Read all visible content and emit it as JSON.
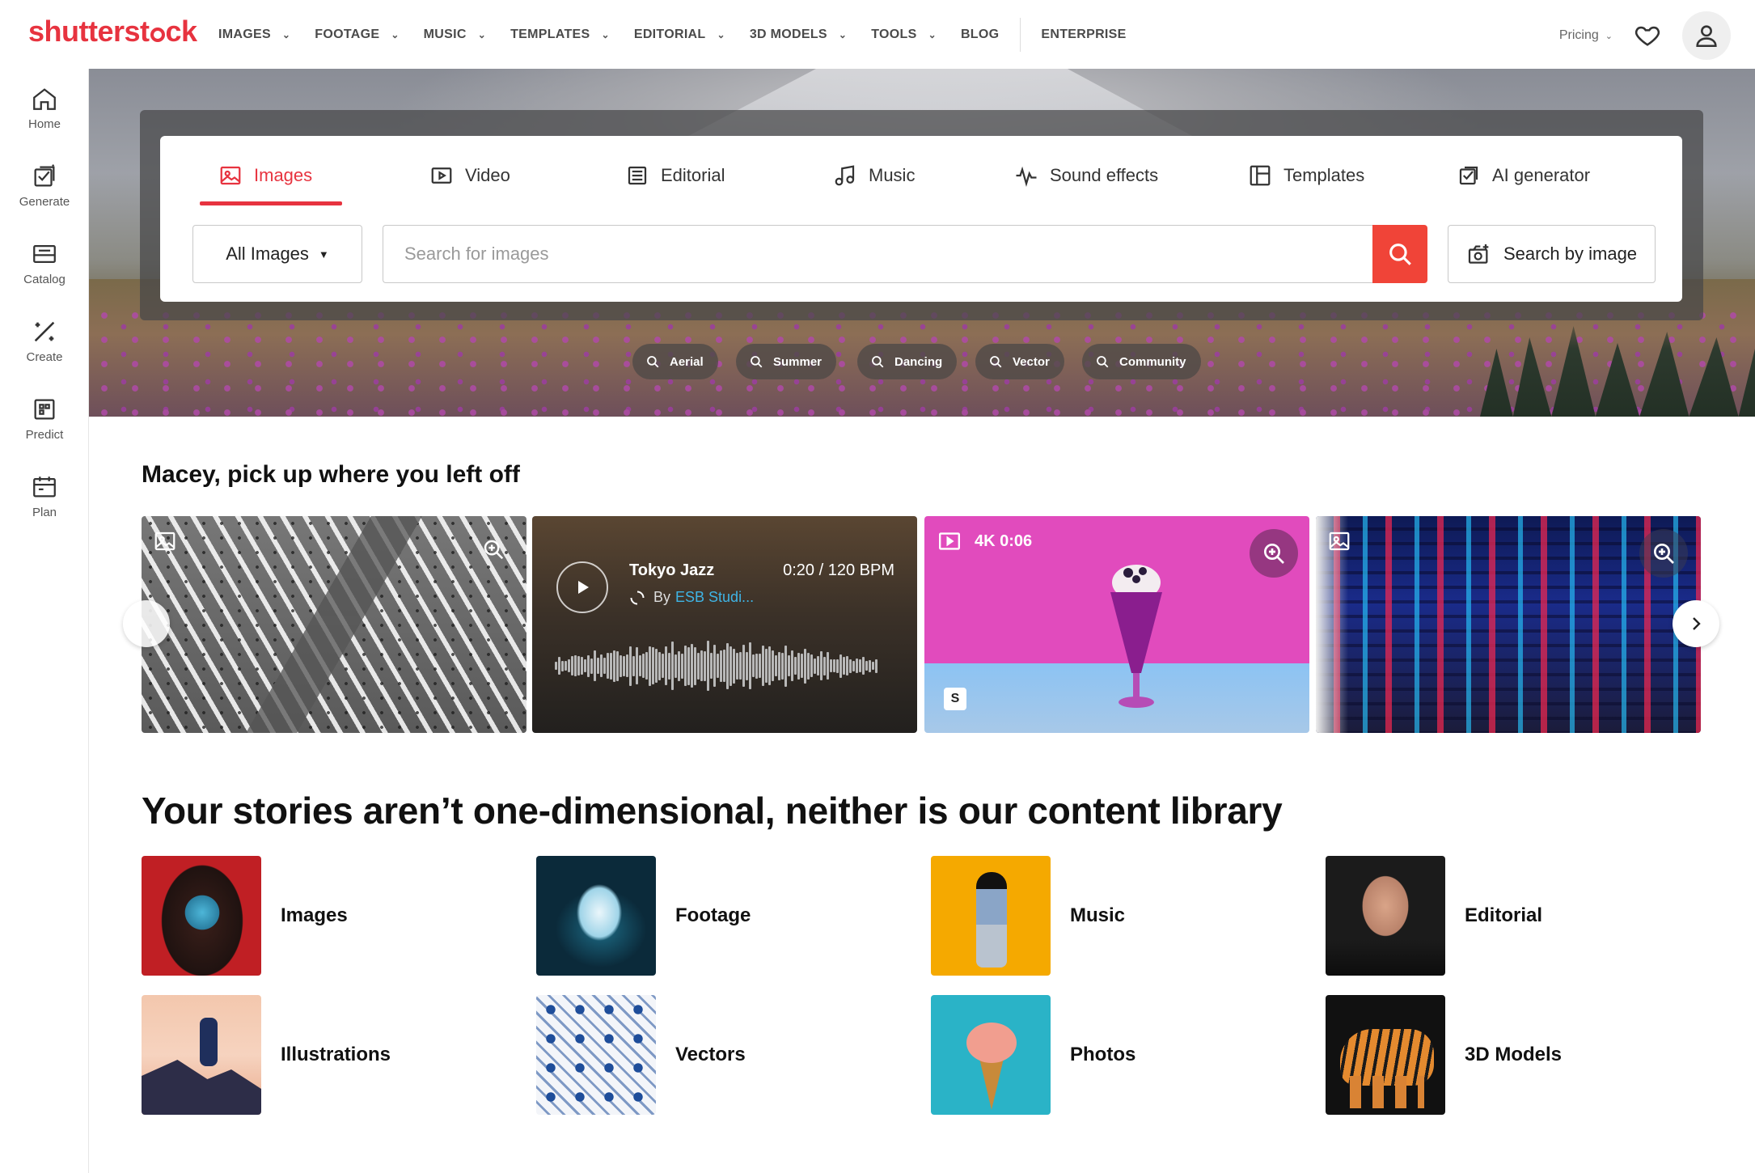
{
  "brand": {
    "logo_text": "shutterstock",
    "accent_color": "#e7333f"
  },
  "nav": {
    "items": [
      {
        "label": "IMAGES",
        "has_menu": true
      },
      {
        "label": "FOOTAGE",
        "has_menu": true
      },
      {
        "label": "MUSIC",
        "has_menu": true
      },
      {
        "label": "TEMPLATES",
        "has_menu": true
      },
      {
        "label": "EDITORIAL",
        "has_menu": true
      },
      {
        "label": "3D MODELS",
        "has_menu": true
      },
      {
        "label": "TOOLS",
        "has_menu": true
      },
      {
        "label": "BLOG",
        "has_menu": false
      },
      {
        "label": "ENTERPRISE",
        "has_menu": false
      }
    ],
    "pricing_label": "Pricing",
    "icons": {
      "favorites": "heart-icon",
      "account": "user-icon"
    }
  },
  "rail": {
    "items": [
      {
        "label": "Home",
        "icon": "home-icon"
      },
      {
        "label": "Generate",
        "icon": "generate-icon"
      },
      {
        "label": "Catalog",
        "icon": "catalog-icon"
      },
      {
        "label": "Create",
        "icon": "create-icon"
      },
      {
        "label": "Predict",
        "icon": "predict-icon"
      },
      {
        "label": "Plan",
        "icon": "plan-icon"
      }
    ]
  },
  "search": {
    "tabs": [
      {
        "label": "Images",
        "icon": "image-icon",
        "active": true
      },
      {
        "label": "Video",
        "icon": "video-icon",
        "active": false
      },
      {
        "label": "Editorial",
        "icon": "editorial-icon",
        "active": false
      },
      {
        "label": "Music",
        "icon": "music-note-icon",
        "active": false
      },
      {
        "label": "Sound effects",
        "icon": "waveform-icon",
        "active": false
      },
      {
        "label": "Templates",
        "icon": "templates-icon",
        "active": false
      },
      {
        "label": "AI generator",
        "icon": "ai-generator-icon",
        "active": false
      }
    ],
    "filter_value": "All Images",
    "placeholder": "Search for images",
    "value": "",
    "search_by_image_label": "Search by image",
    "suggestions": [
      "Aerial",
      "Summer",
      "Dancing",
      "Vector",
      "Community"
    ]
  },
  "continue_section": {
    "title": "Macey, pick up where you left off",
    "music_card": {
      "title": "Tokyo Jazz",
      "meta": "0:20 / 120 BPM",
      "by_prefix": "By",
      "artist": "ESB Studi..."
    },
    "video_card": {
      "meta": "4K 0:06",
      "badge": "S"
    }
  },
  "library": {
    "title": "Your stories aren’t one-dimensional, neither is our content library",
    "items": [
      {
        "label": "Images"
      },
      {
        "label": "Footage"
      },
      {
        "label": "Music"
      },
      {
        "label": "Editorial"
      },
      {
        "label": "Illustrations"
      },
      {
        "label": "Vectors"
      },
      {
        "label": "Photos"
      },
      {
        "label": "3D Models"
      }
    ]
  }
}
